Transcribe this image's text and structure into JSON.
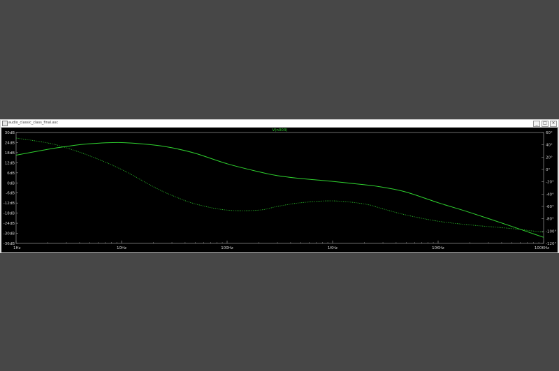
{
  "window": {
    "title": "audio_classic_class_final.asc",
    "buttons": [
      "_",
      "□",
      "×"
    ]
  },
  "colors": {
    "background": "#474747",
    "plot_bg": "#000000",
    "trace": "#2fd22f",
    "axis_text": "#d0d0d0",
    "frame": "#9a9a9a"
  },
  "chart_data": {
    "type": "line",
    "title": "V(n003)",
    "xscale": "log",
    "xlim": [
      1,
      100000
    ],
    "x_ticks": [
      {
        "value": 1,
        "label": "1Hz"
      },
      {
        "value": 10,
        "label": "10Hz"
      },
      {
        "value": 100,
        "label": "100Hz"
      },
      {
        "value": 1000,
        "label": "1KHz"
      },
      {
        "value": 10000,
        "label": "10KHz"
      },
      {
        "value": 100000,
        "label": "100KHz"
      }
    ],
    "y_left": {
      "unit": "dB",
      "ylim": [
        -36,
        30
      ],
      "ticks": [
        "30dB",
        "24dB",
        "18dB",
        "12dB",
        "6dB",
        "0dB",
        "-6dB",
        "-12dB",
        "-18dB",
        "-24dB",
        "-30dB",
        "-36dB"
      ]
    },
    "y_right": {
      "unit": "°",
      "ylim": [
        -120,
        60
      ],
      "ticks": [
        "60°",
        "40°",
        "20°",
        "0°",
        "-20°",
        "-40°",
        "-60°",
        "-80°",
        "-100°",
        "-120°"
      ]
    },
    "series": [
      {
        "kind": "magnitude",
        "style": "solid",
        "axis": "left",
        "x": [
          1,
          2,
          3,
          5,
          10,
          20,
          30,
          50,
          100,
          200,
          300,
          500,
          1000,
          2000,
          3000,
          5000,
          10000,
          20000,
          50000,
          100000
        ],
        "y": [
          16.5,
          20.0,
          21.7,
          23.3,
          24.0,
          22.6,
          20.9,
          17.6,
          11.4,
          6.6,
          4.3,
          2.6,
          0.9,
          -1.1,
          -2.6,
          -5.5,
          -11.8,
          -17.6,
          -25.9,
          -32.4
        ]
      },
      {
        "kind": "phase",
        "style": "dotted",
        "axis": "right",
        "x": [
          1,
          2,
          3,
          5,
          10,
          20,
          30,
          50,
          100,
          200,
          300,
          500,
          1000,
          2000,
          3000,
          5000,
          10000,
          20000,
          50000,
          100000
        ],
        "y": [
          51,
          43,
          35,
          22,
          0,
          -28,
          -42,
          -56,
          -66,
          -66,
          -60,
          -54,
          -51,
          -56,
          -64,
          -74,
          -84,
          -90,
          -96,
          -102
        ]
      }
    ]
  }
}
